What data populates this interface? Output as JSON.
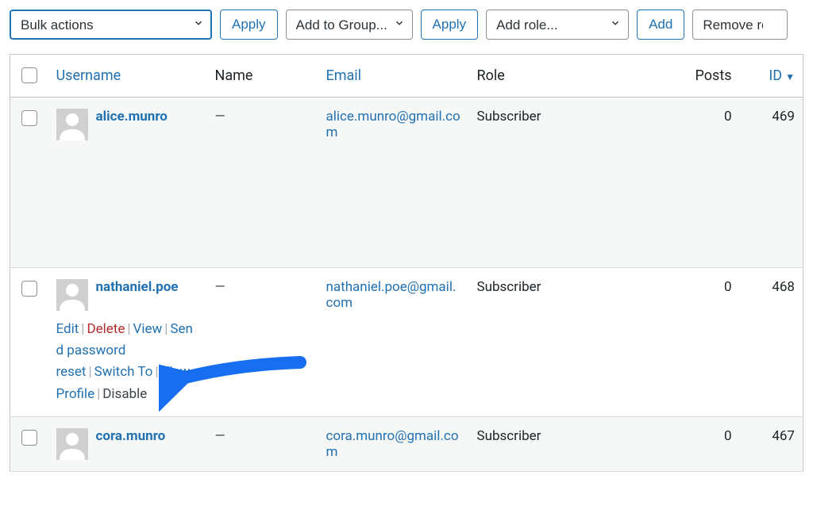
{
  "toolbar": {
    "bulk_actions": "Bulk actions",
    "apply": "Apply",
    "add_to_group": "Add to Group...",
    "apply2": "Apply",
    "add_role": "Add role...",
    "add": "Add",
    "remove_role": "Remove role..."
  },
  "columns": {
    "username": "Username",
    "name": "Name",
    "email": "Email",
    "role": "Role",
    "posts": "Posts",
    "id": "ID"
  },
  "rows": [
    {
      "username": "alice.munro",
      "name": "—",
      "email": "alice.munro@gmail.com",
      "role": "Subscriber",
      "posts": "0",
      "id": "469",
      "actions_visible": false
    },
    {
      "username": "nathaniel.poe",
      "name": "—",
      "email": "nathaniel.poe@gmail.com",
      "role": "Subscriber",
      "posts": "0",
      "id": "468",
      "actions_visible": true
    },
    {
      "username": "cora.munro",
      "name": "—",
      "email": "cora.munro@gmail.com",
      "role": "Subscriber",
      "posts": "0",
      "id": "467",
      "actions_visible": false
    }
  ],
  "row_actions": {
    "edit": "Edit",
    "delete": "Delete",
    "view": "View",
    "send_password_reset": "Send password reset",
    "switch_to": "Switch To",
    "view_profile": "View Profile",
    "disable": "Disable"
  },
  "annotation": {
    "arrow_color": "#186ef0"
  }
}
